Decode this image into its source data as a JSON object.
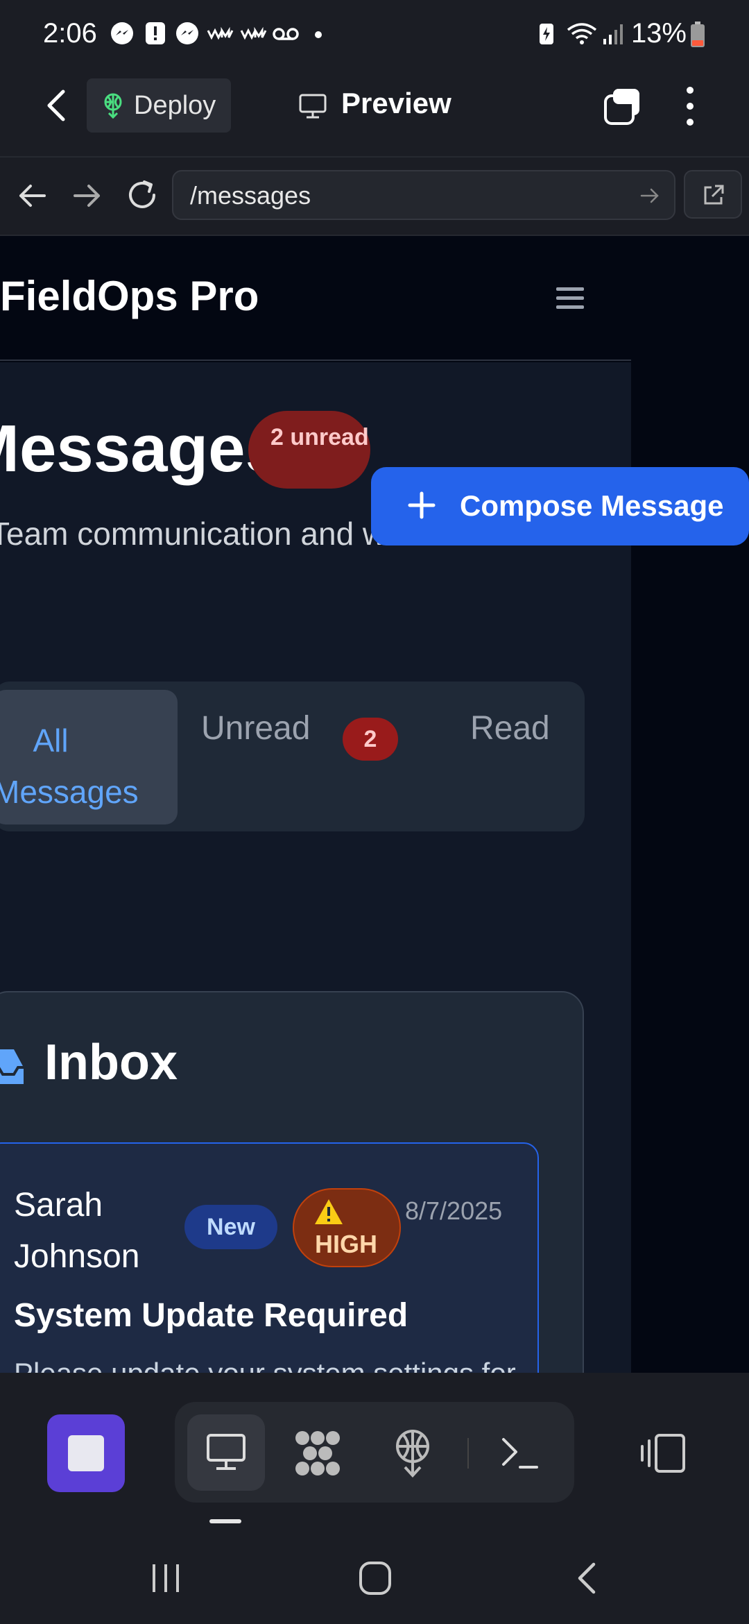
{
  "status_bar": {
    "time": "2:06",
    "battery_percent": "13%",
    "icons": [
      "messenger-icon",
      "alert-icon",
      "messenger-icon",
      "wm-icon",
      "wm-icon",
      "voicemail-icon",
      "dot-icon",
      "battery-saver-icon",
      "wifi-icon",
      "signal-icon",
      "battery-icon"
    ]
  },
  "app_header": {
    "deploy_label": "Deploy",
    "preview_label": "Preview"
  },
  "browser": {
    "url": "/messages"
  },
  "site": {
    "brand": "FieldOps Pro"
  },
  "page": {
    "title": "Messages",
    "unread_badge": "2 unread",
    "subtitle": "Team communication and work order discussions",
    "compose_label": "Compose Message"
  },
  "filters": {
    "all_label": "All Messages",
    "unread_label": "Unread",
    "unread_count": "2",
    "read_label": "Read"
  },
  "inbox": {
    "title": "Inbox",
    "messages": [
      {
        "sender": "Sarah Johnson",
        "status": "New",
        "priority": "HIGH",
        "date": "8/7/2025",
        "subject": "System Update Required",
        "preview": "Please update your system settings for the new security protocols."
      }
    ]
  },
  "colors": {
    "accent": "#2563eb",
    "unread_badge": "#7f1d1d",
    "priority_high": "#7c2d12",
    "stop_button": "#5b3fd6"
  }
}
